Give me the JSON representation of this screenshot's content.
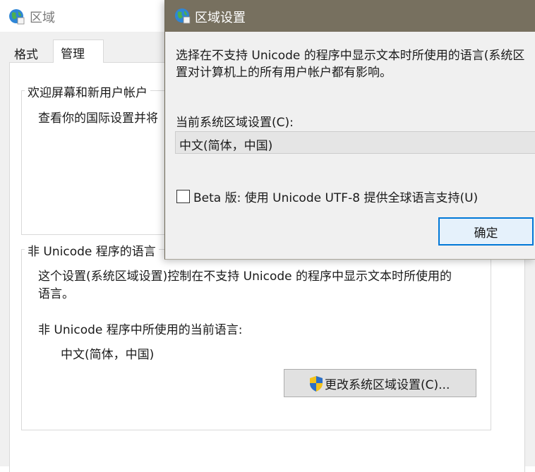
{
  "back_window": {
    "title": "区域",
    "tabs": [
      "格式",
      "管理"
    ],
    "welcome_group": {
      "title": "欢迎屏幕和新用户帐户",
      "text": "查看你的国际设置并将"
    },
    "nonunicode_group": {
      "title": "非 Unicode 程序的语言",
      "desc_line1": "这个设置(系统区域设置)控制在不支持 Unicode 的程序中显示文本时所使用的",
      "desc_line2": "语言。",
      "current_label": "非 Unicode 程序中所使用的当前语言:",
      "current_value": "中文(简体，中国)",
      "change_button": "更改系统区域设置(C)..."
    }
  },
  "dialog": {
    "title": "区域设置",
    "desc": "选择在不支持 Unicode 的程序中显示文本时所使用的语言(系统区\n置对计算机上的所有用户帐户都有影响。",
    "current_label": "当前系统区域设置(C):",
    "current_value": "中文(简体，中国)",
    "beta_checkbox": {
      "label": "Beta 版: 使用 Unicode UTF-8 提供全球语言支持(U)",
      "checked": false
    },
    "ok_button": "确定"
  },
  "colors": {
    "dialog_titlebar": "#77705f",
    "accent": "#0078d7"
  }
}
